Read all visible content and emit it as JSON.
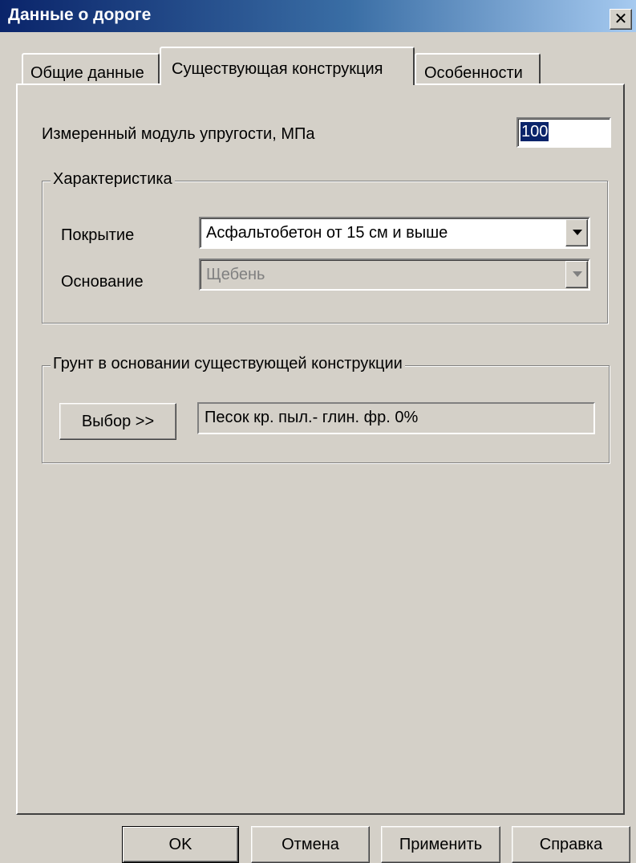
{
  "window": {
    "title": "Данные о дороге",
    "close_glyph": "✕"
  },
  "tabs": [
    {
      "label": "Общие данные",
      "active": false
    },
    {
      "label": "Существующая конструкция",
      "active": true
    },
    {
      "label": "Особенности",
      "active": false
    }
  ],
  "modulus": {
    "label": "Измеренный модуль упругости, МПа",
    "value": "100"
  },
  "characteristics": {
    "legend": "Характеристика",
    "coating_label": "Покрытие",
    "coating_value": "Асфальтобетон от 15 см и выше",
    "base_label": "Основание",
    "base_value": "Щебень",
    "base_enabled": false
  },
  "soil": {
    "legend": "Грунт в основании существующей конструкции",
    "choose_label": "Выбор >>",
    "value": "Песок кр. пыл.- глин. фр. 0%"
  },
  "footer": {
    "ok_label": "OK",
    "cancel_label": "Отмена",
    "apply_label": "Применить",
    "help_label": "Справка"
  },
  "colors": {
    "face": "#d4d0c8",
    "title_start": "#0a246a",
    "title_end": "#a6caf0",
    "selection": "#0a246a"
  }
}
